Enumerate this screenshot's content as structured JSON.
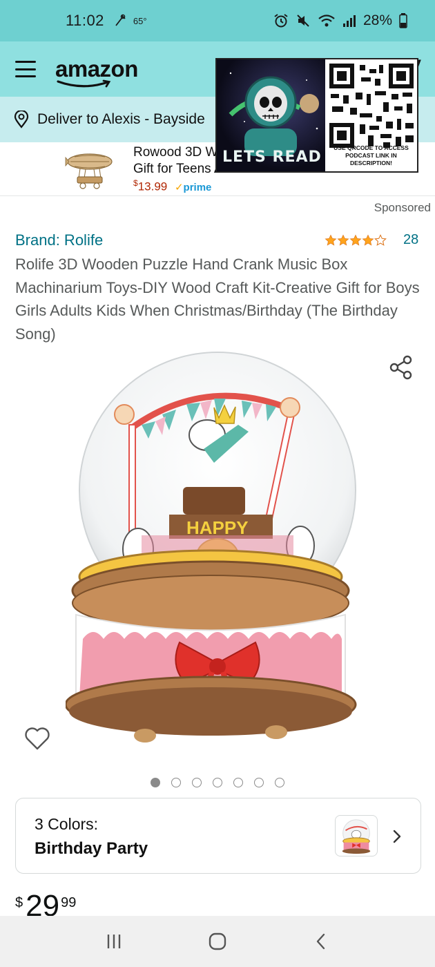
{
  "status_bar": {
    "time": "11:02",
    "temperature": "65°",
    "battery": "28%"
  },
  "header": {
    "logo_text": "amazon",
    "cart_hint": "y"
  },
  "deliver": {
    "text": "Deliver to Alexis - Bayside"
  },
  "ad": {
    "title": "Rowood 3D Wooden Puzzle Airship Best Toys Gift for Teens Adults",
    "price_symbol": "$",
    "price": "13.99",
    "prime_label": "prime"
  },
  "overlay": {
    "caption": "LETS READ",
    "qr_caption": "USE QRCODE TO ACCESS PODCAST LINK IN DESCRIPTION!"
  },
  "sponsored_label": "Sponsored",
  "product": {
    "brand": "Brand: Rolife",
    "rating_count": "28",
    "rating_value": 4.5,
    "title": "Rolife 3D Wooden Puzzle Hand Crank Music Box Machinarium Toys-DIY Wood Craft Kit-Creative Gift for Boys Girls Adults Kids When Christmas/Birthday (The Birthday Song)"
  },
  "carousel": {
    "total": 7,
    "active_index": 0
  },
  "variation": {
    "count_label": "3 Colors:",
    "selected": "Birthday Party"
  },
  "price": {
    "symbol": "$",
    "whole": "29",
    "fraction": "99"
  },
  "colors": {
    "status_bar": "#6ed0d0",
    "header": "#8fe0e0",
    "deliver_bar": "#c6ecee",
    "link": "#007185",
    "star": "#ffa41c",
    "price_red": "#b12704"
  }
}
